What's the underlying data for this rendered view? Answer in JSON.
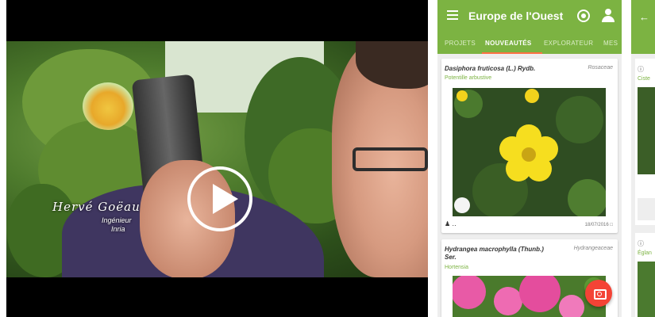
{
  "video": {
    "caption_name": "Hervé Goëau",
    "caption_title": "Ingénieur",
    "caption_org": "Inria",
    "play_icon": "play-circle-icon"
  },
  "app": {
    "accent": "#7cb342",
    "indicator": "#ff7043",
    "fab_color": "#f44336",
    "title": "Europe de l'Ouest",
    "tabs": [
      "PROJETS",
      "NOUVEAUTÉS",
      "EXPLORATEUR",
      "MES"
    ],
    "active_tab": "NOUVEAUTÉS",
    "cards": [
      {
        "scientific_name": "Dasiphora fruticosa (L.) Rydb.",
        "family": "Rosaceae",
        "common_name": "Potentille arbustive",
        "user": "‥",
        "date": "18/07/2016"
      },
      {
        "scientific_name": "Hydrangea macrophylla (Thunb.) Ser.",
        "family": "Hydrangeaceae",
        "common_name": "Hortensia"
      }
    ]
  },
  "panel3": {
    "label_top": "Ciste",
    "label_bottom": "Églan"
  }
}
